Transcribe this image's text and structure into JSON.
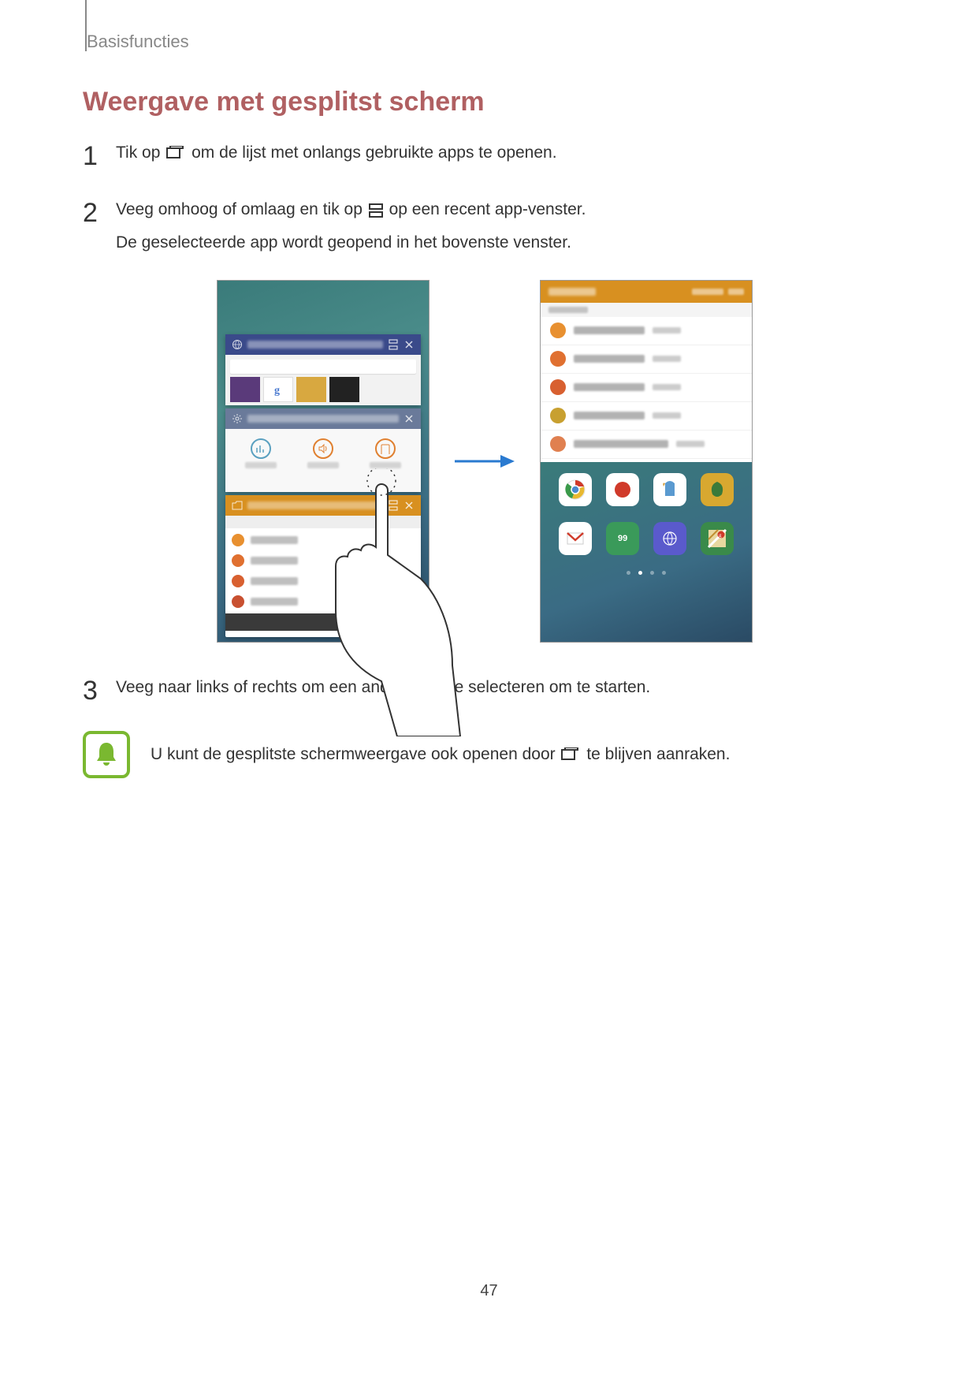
{
  "breadcrumb": "Basisfuncties",
  "section_title": "Weergave met gesplitst scherm",
  "steps": {
    "s1": {
      "num": "1",
      "text_a": "Tik op ",
      "text_b": " om de lijst met onlangs gebruikte apps te openen."
    },
    "s2": {
      "num": "2",
      "line1_a": "Veeg omhoog of omlaag en tik op ",
      "line1_b": " op een recent app-venster.",
      "line2": "De geselecteerde app wordt geopend in het bovenste venster."
    },
    "s3": {
      "num": "3",
      "text": "Veeg naar links of rechts om een andere app te selecteren om te starten."
    }
  },
  "note": {
    "text_a": "U kunt de gesplitste schermweergave ook openen door ",
    "text_b": " te blijven aanraken."
  },
  "page_number": "47"
}
